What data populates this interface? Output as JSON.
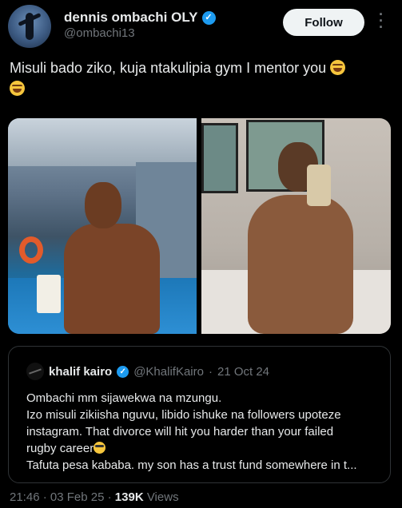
{
  "author": {
    "display_name": "dennis ombachi OLY",
    "handle": "@ombachi13",
    "verified_icon": "verified-badge-icon",
    "follow_label": "Follow"
  },
  "tweet": {
    "text": "Misuli bado ziko, kuja ntakulipia gym I mentor you",
    "emoji_icon": "grinning-sweat-emoji-icon"
  },
  "media": {
    "items": [
      "photo",
      "photo"
    ]
  },
  "quoted_tweet": {
    "name": "khalif kairo",
    "handle": "@KhalifKairo",
    "date": "21 Oct 24",
    "separator": "·",
    "lines": [
      "Ombachi mm sijawekwa na mzungu.",
      "Izo misuli zikiisha nguvu, libido ishuke na followers upoteze",
      "instagram. That divorce will hit you harder than your failed",
      "rugby career",
      "Tafuta pesa kababa. my son has a trust fund somewhere in t..."
    ]
  },
  "footer": {
    "time": "21:46",
    "date": "03 Feb 25",
    "views": "139K",
    "views_label": "Views",
    "separator": "·"
  },
  "colors": {
    "background": "#000000",
    "text": "#e7e9ea",
    "secondary": "#71767b",
    "verified": "#1d9bf0",
    "follow_bg": "#eff3f4"
  }
}
